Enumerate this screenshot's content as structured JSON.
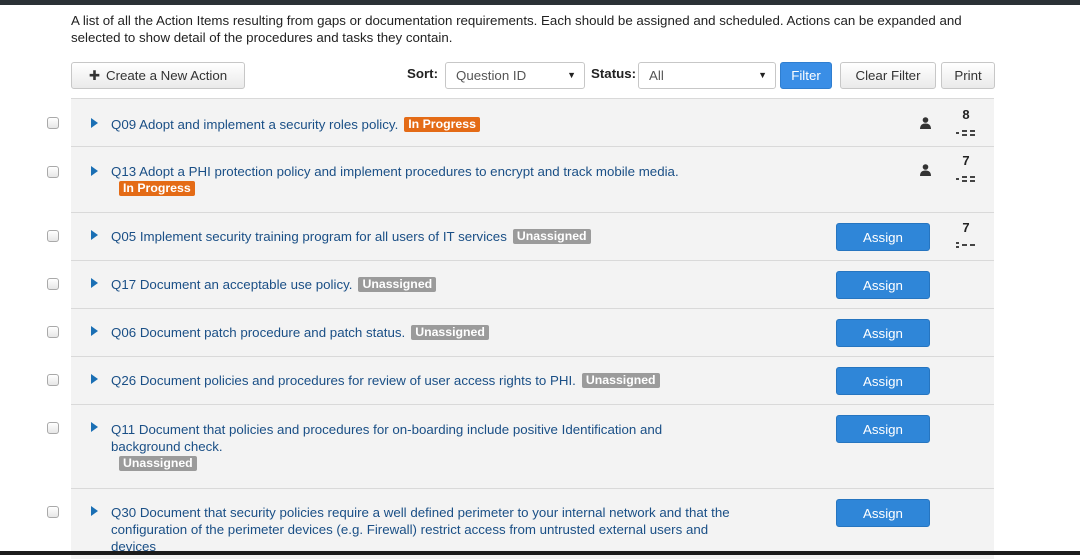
{
  "description": "A list of all the Action Items resulting from gaps or documentation requirements. Each should be assigned and scheduled. Actions can be expanded and selected to show detail of the procedures and tasks they contain.",
  "toolbar": {
    "new_action_label": "Create a New Action",
    "sort_label": "Sort:",
    "sort_value": "Question ID",
    "status_label": "Status:",
    "status_value": "All",
    "filter_label": "Filter",
    "clear_filter_label": "Clear Filter",
    "print_label": "Print"
  },
  "actions": [
    {
      "title": "Q09 Adopt and implement a security roles policy.",
      "status": "In Progress",
      "count": "8"
    },
    {
      "title": "Q13 Adopt a PHI protection policy and implement procedures to encrypt and track mobile media.",
      "status": "In Progress",
      "count": "7"
    },
    {
      "title": "Q05 Implement security training program for all users of IT services",
      "status": "Unassigned",
      "assign": "Assign",
      "count": "7"
    },
    {
      "title": "Q17 Document an acceptable use policy.",
      "status": "Unassigned",
      "assign": "Assign"
    },
    {
      "title": "Q06 Document patch procedure and patch status.",
      "status": "Unassigned",
      "assign": "Assign"
    },
    {
      "title": "Q26 Document policies and procedures for review of user access rights to PHI.",
      "status": "Unassigned",
      "assign": "Assign"
    },
    {
      "title": "Q11 Document that policies and procedures for on-boarding include positive Identification and background check.",
      "status": "Unassigned",
      "assign": "Assign"
    },
    {
      "title": "Q30 Document that security policies require a well defined perimeter to your internal network and that the configuration of the perimeter devices (e.g. Firewall) restrict access from untrusted external users and devices",
      "assign": "Assign"
    }
  ],
  "colors": {
    "in_progress": "#e46b16",
    "unassigned": "#9b9b9b",
    "primary_button": "#2f86d8",
    "link_text": "#1a4f86"
  },
  "icons": [
    "plus-icon",
    "expand-triangle-icon",
    "person-icon",
    "task-dots-icon",
    "caret-down-icon"
  ]
}
